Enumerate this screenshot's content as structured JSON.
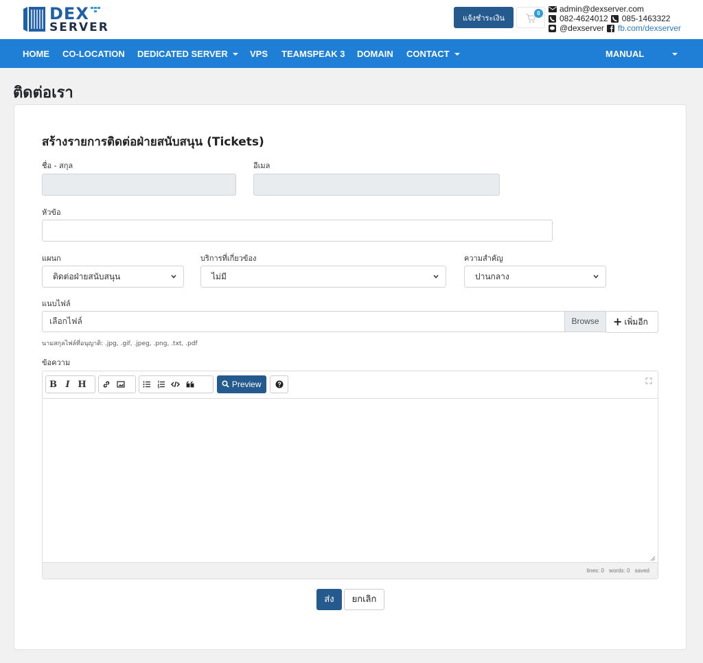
{
  "header": {
    "brand_top": "DEX",
    "brand_bottom": "SERVER",
    "pay_button": "แจ้งชำระเงิน",
    "cart_count": "0",
    "email": "admin@dexserver.com",
    "phone1": "082-4624012",
    "phone2": "085-1463322",
    "line_id": "@dexserver",
    "facebook": "fb.com/dexserver"
  },
  "nav": {
    "home": "HOME",
    "colocation": "CO-LOCATION",
    "dedicated": "DEDICATED SERVER",
    "vps": "VPS",
    "teamspeak": "TEAMSPEAK 3",
    "domain": "DOMAIN",
    "contact": "CONTACT",
    "manual": "MANUAL"
  },
  "page": {
    "title": "ติดต่อเรา",
    "heading": "สร้างรายการติดต่อฝ่ายสนับสนุน (Tickets)"
  },
  "form": {
    "name_label": "ชื่อ - สกุล",
    "name_value": "",
    "email_label": "อีเมล",
    "email_value": "",
    "subject_label": "หัวข้อ",
    "subject_value": "",
    "department_label": "แผนก",
    "department_value": "ติดต่อฝ่ายสนับสนุน",
    "service_label": "บริการที่เกี่ยวข้อง",
    "service_value": "ไม่มี",
    "priority_label": "ความสำคัญ",
    "priority_value": "ปานกลาง",
    "attachment_label": "แนบไฟล์",
    "file_placeholder": "เลือกไฟล์",
    "browse": "Browse",
    "add_more": "เพิ่มอีก",
    "allowed_ext": "นามสกุลไฟล์ที่อนุญาติ: .jpg, .gif, .jpeg, .png, .txt, .pdf",
    "message_label": "ข้อความ"
  },
  "editor": {
    "bold": "B",
    "italic": "I",
    "heading": "H",
    "preview": "Preview",
    "status_lines": "lines: 0",
    "status_words": "words: 0",
    "status_saved": "saved"
  },
  "actions": {
    "submit": "ส่ง",
    "cancel": "ยกเลิก"
  }
}
